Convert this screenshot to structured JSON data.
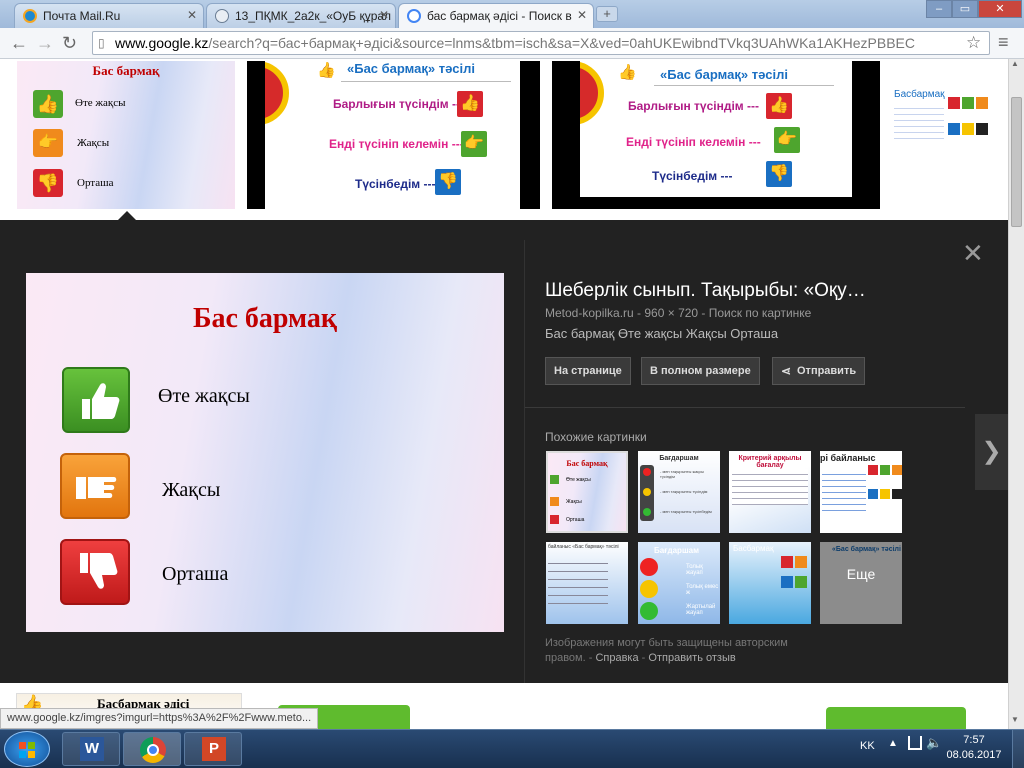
{
  "browser": {
    "tabs": [
      {
        "title": "Почта Mail.Ru"
      },
      {
        "title": "13_ПҚМК_2а2к_«ОуБ құрал"
      },
      {
        "title": "бас бармақ әдісі - Поиск в"
      }
    ],
    "url_host": "www.google.kz",
    "url_path": "/search?q=бас+бармақ+әдісі&source=lnms&tbm=isch&sa=X&ved=0ahUKEwibndTVkq3UAhWKa1AKHezPBBEC"
  },
  "top_results": [
    {
      "title": "Бас бармақ",
      "rows": [
        "Өте жақсы",
        "Жақсы",
        "Орташа"
      ]
    },
    {
      "title": "«Бас бармақ» тәсілі",
      "rows": [
        "Барлығын түсіндім ---",
        "Енді түсініп келемін ---",
        "Түсінбедім ---"
      ]
    },
    {
      "title": "«Бас бармақ» тәсілі",
      "rows": [
        "Барлығын түсіндім ---",
        "Енді түсініп келемін ---",
        "Түсінбедім ---"
      ]
    },
    {
      "title": "Басбармақ"
    }
  ],
  "preview": {
    "slide_title": "Бас бармақ",
    "items": [
      "Өте жақсы",
      "Жақсы",
      "Орташа"
    ],
    "title": "Шеберлік сынып. Тақырыбы: «Оқу…",
    "meta": "Metod-kopilka.ru - 960 × 720 - Поиск по картинке",
    "desc": "Бас бармақ Өте жақсы Жақсы Орташа",
    "buttons": [
      "На странице",
      "В полном размере",
      "Отправить"
    ],
    "similar_label": "Похожие картинки",
    "more_label": "Еще",
    "similar": [
      {
        "title": "Бас бармақ",
        "rows": [
          "Өте жақсы",
          "Жақсы",
          "Орташа"
        ]
      },
      {
        "title": "Бағдаршам",
        "rows": [
          "- мен тақырыпты жақсы түсіндім",
          "- мен тақырыпты түсіндім",
          "- мен тақырыпты түсінбедім"
        ]
      },
      {
        "title": "Критерий арқылы бағалау"
      },
      {
        "title": "рі байланыс"
      },
      {
        "title": "байланыс «Бас бармақ» тәсілі"
      },
      {
        "title": "Бағдаршам",
        "rows": [
          "Толық жауап",
          "Толық емес ж",
          "Жартылай жауап"
        ]
      },
      {
        "title": "Басбармақ"
      },
      {
        "title": "«Бас бармақ» тәсілі"
      }
    ],
    "disclaimer": "Изображения могут быть защищены авторским правом.",
    "help_link": "Справка",
    "feedback_link": "Отправить отзыв"
  },
  "bottom": {
    "thumb_title": "Басбармақ әдісі",
    "status_url": "www.google.kz/imgres?imgurl=https%3A%2F%2Fwww.meto..."
  },
  "taskbar": {
    "lang": "KK",
    "time": "7:57",
    "date": "08.06.2017"
  },
  "colors": {
    "good": "#4ea52e",
    "ok": "#f08a1c",
    "bad": "#d8262e",
    "blue": "#1a6fc2",
    "slide_title": "#c00000"
  }
}
